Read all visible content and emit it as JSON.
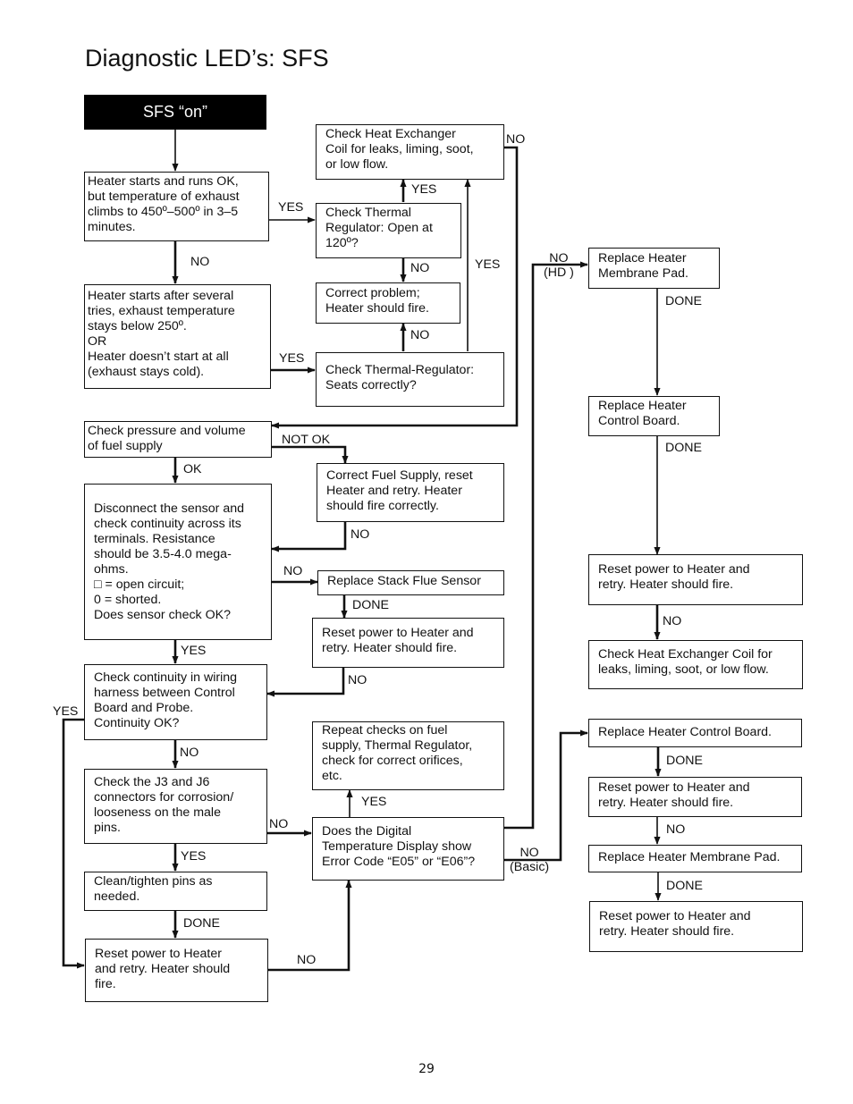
{
  "page": {
    "title": "Diagnostic LED’s: SFS",
    "page_number": "29"
  },
  "flowchart": {
    "start": "SFS “on”",
    "nodes": {
      "heater_runs_ok": "Heater starts and runs OK,\nbut temperature of exhaust\nclimbs to 450º–500º in 3–5\nminutes.",
      "check_heat_exchanger_top": "Check Heat Exchanger\nCoil for leaks, liming, soot,\nor low flow.",
      "check_thermal_regulator_open": "Check Thermal\nRegulator: Open at\n120º?",
      "correct_problem": "Correct problem;\nHeater should fire.",
      "heater_starts_after_tries": "Heater starts after several\ntries, exhaust temperature\nstays below 250º.\n                OR\nHeater doesn’t start at all\n(exhaust stays cold).",
      "check_thermal_regulator_seats": "Check Thermal-Regulator:\nSeats correctly?",
      "check_fuel_supply": "Check pressure and volume\nof fuel supply",
      "correct_fuel_supply": "Correct Fuel Supply, reset\nHeater and retry. Heater\nshould fire correctly.",
      "disconnect_sensor": "Disconnect the sensor and\ncheck continuity across its\nterminals. Resistance\nshould be 3.5-4.0 mega-\nohms.\n     □ = open circuit;\n     0 = shorted.\nDoes sensor check OK?",
      "replace_stack_flue_sensor": "Replace Stack Flue Sensor",
      "reset_power_1": "Reset power to Heater and\nretry. Heater should fire.",
      "check_wiring_continuity": "Check continuity in wiring\nharness between Control\nBoard and Probe.\nContinuity OK?",
      "repeat_checks": "Repeat checks on fuel\nsupply, Thermal Regulator,\ncheck for correct orifices,\netc.",
      "check_j3_j6": "Check the J3 and J6\nconnectors for corrosion/\nlooseness on the male\npins.",
      "digital_display_error": "Does the Digital\nTemperature Display show\nError Code “E05” or “E06”?",
      "clean_tighten_pins": "Clean/tighten pins as\nneeded.",
      "reset_power_2": "Reset power to Heater\nand retry. Heater should\nfire.",
      "hd_replace_membrane": "Replace Heater\nMembrane Pad.",
      "hd_replace_control_board": "Replace Heater\nControl Board.",
      "hd_reset_power": "Reset power to Heater and\nretry. Heater should fire.",
      "hd_check_heat_exchanger": "Check Heat Exchanger Coil for\nleaks, liming, soot, or low flow.",
      "basic_replace_control_board": "Replace Heater Control Board.",
      "basic_reset_power_1": "Reset power to Heater and\nretry. Heater should fire.",
      "basic_replace_membrane": "Replace Heater Membrane Pad.",
      "basic_reset_power_2": "Reset power to Heater and\nretry. Heater should fire."
    },
    "edge_labels": {
      "runs_ok_yes": "YES",
      "runs_ok_no": "NO",
      "regulator_open_yes": "YES",
      "regulator_open_no": "NO",
      "seats_no": "NO",
      "seats_yes": "YES",
      "heat_exchanger_no": "NO",
      "after_tries_yes": "YES",
      "fuel_not_ok": "NOT OK",
      "fuel_ok": "OK",
      "correct_fuel_no": "NO",
      "sensor_no": "NO",
      "sensor_yes": "YES",
      "flue_done": "DONE",
      "reset1_no": "NO",
      "wiring_yes": "YES",
      "wiring_no": "NO",
      "j3_no": "NO",
      "j3_yes": "YES",
      "clean_done": "DONE",
      "reset2_no": "NO",
      "display_yes": "YES",
      "hd_no": "NO\n(HD )",
      "basic_no": "NO\n(Basic)",
      "hd_membrane_done": "DONE",
      "hd_board_done": "DONE",
      "hd_reset_no": "NO",
      "basic_board_done": "DONE",
      "basic_reset_no": "NO",
      "basic_membrane_done": "DONE"
    }
  }
}
